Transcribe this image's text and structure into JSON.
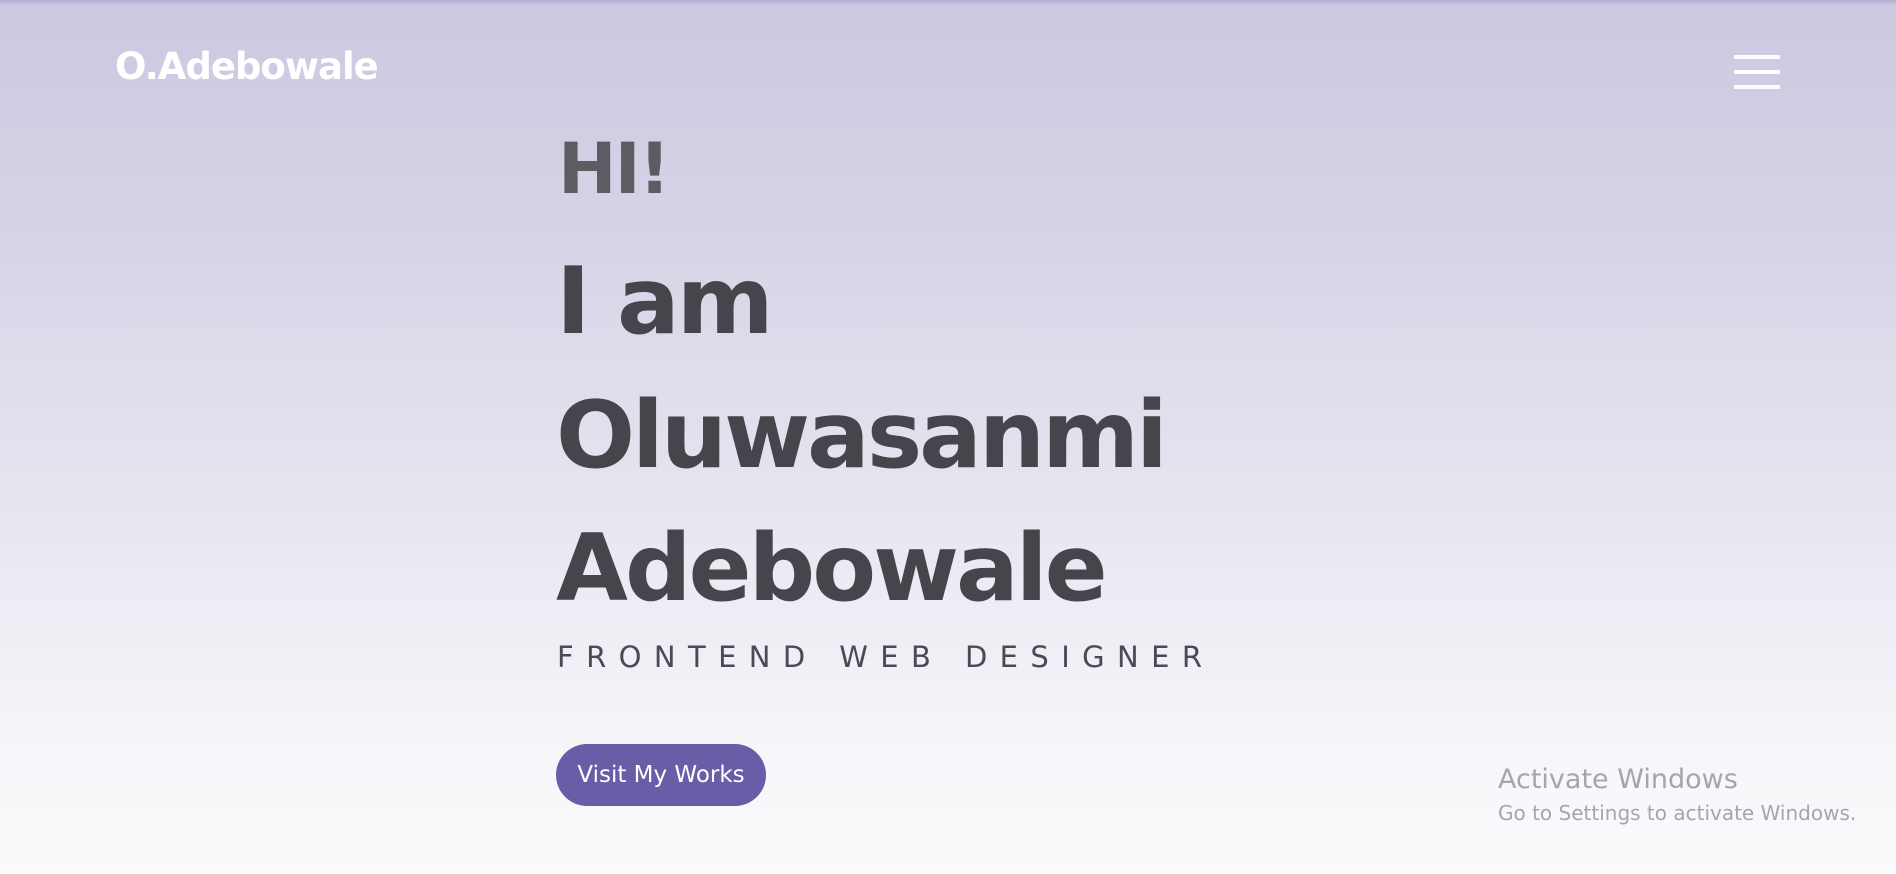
{
  "header": {
    "logo": "O.Adebowale",
    "menu_icon": "hamburger-menu-icon"
  },
  "hero": {
    "greeting": "HI!",
    "line1": "I am",
    "line2": "Oluwasanmi",
    "line3": "Adebowale",
    "subtitle": "FRONTEND WEB DESIGNER",
    "cta_label": "Visit My Works"
  },
  "watermark": {
    "title": "Activate Windows",
    "subtitle": "Go to Settings to activate Windows."
  },
  "colors": {
    "accent": "#6a5ca6",
    "heading": "#45464c",
    "greeting": "#5e5c63",
    "background_top": "#cdc7e0",
    "background_bottom": "#fbfbfc"
  }
}
